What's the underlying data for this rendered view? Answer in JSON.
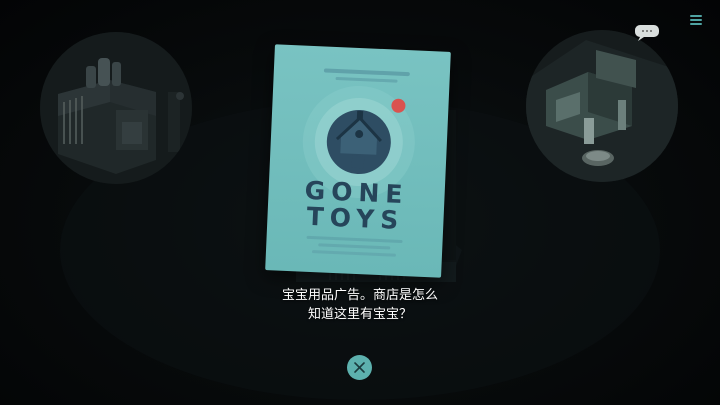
{
  "item": {
    "poster_title_line1": "GONE",
    "poster_title_line2": "TOYS"
  },
  "dialog": {
    "caption_line1": "宝宝用品广告。商店是怎么",
    "caption_line2": "知道这里有宝宝？"
  },
  "icons": {
    "menu": "hamburger-menu-icon",
    "close": "close-x-icon",
    "poster_logo": "house-on-circle-icon",
    "poster_sticker": "red-dot-icon",
    "left_scene": "kitchen-building-scene",
    "right_scene": "room-furniture-scene"
  },
  "colors": {
    "background": "#050708",
    "poster": "#72bebd",
    "poster_dark": "#26455a",
    "accent": "#5db1ae",
    "sticker": "#d9534f",
    "text": "#ffffff"
  }
}
